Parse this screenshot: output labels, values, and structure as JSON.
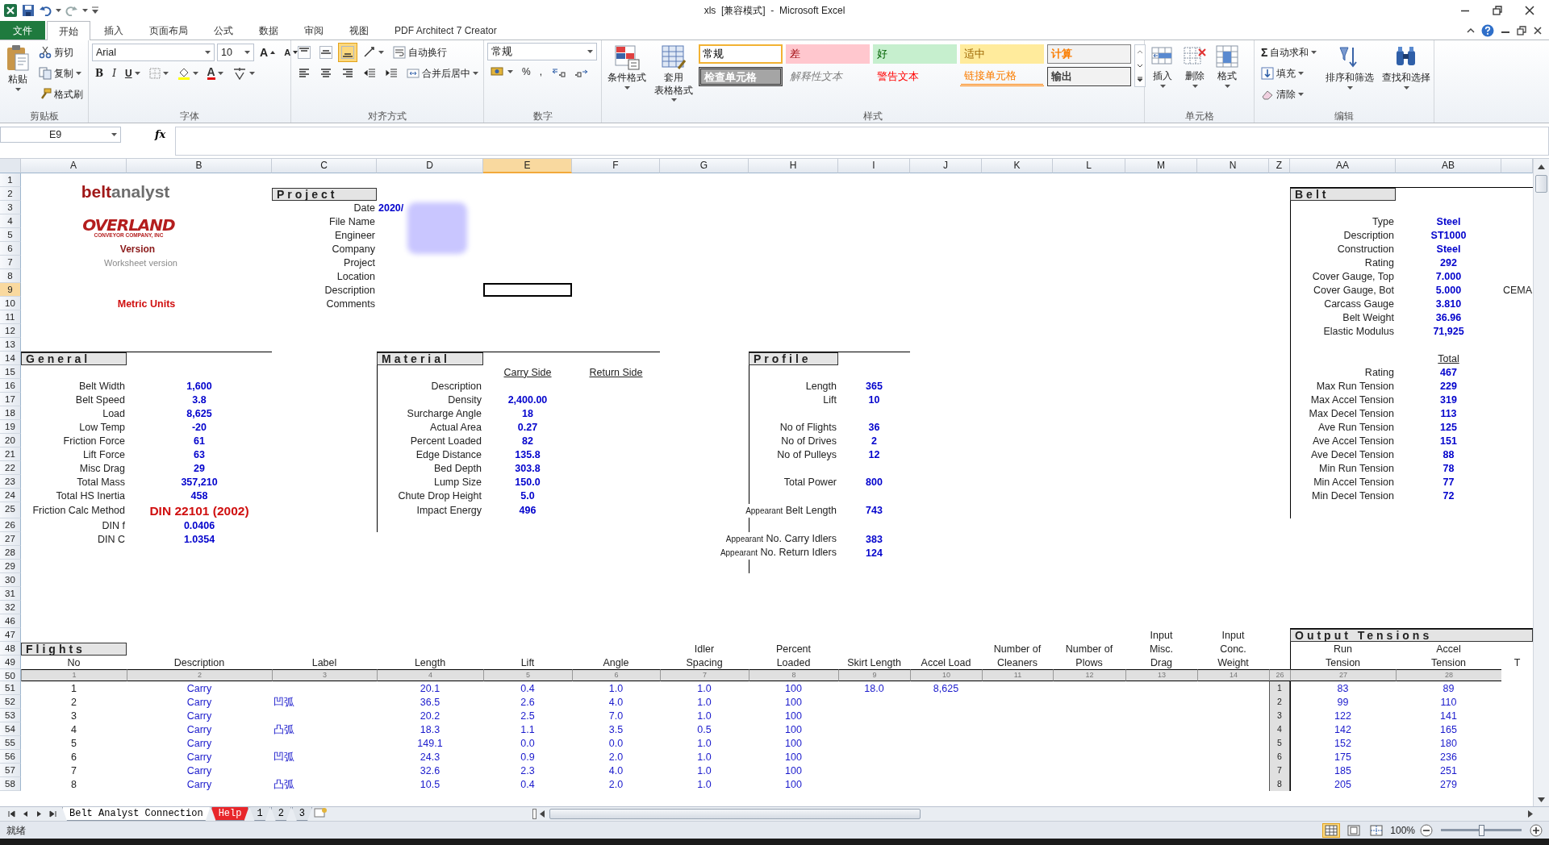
{
  "window": {
    "title": "xls  [兼容模式]  -  Microsoft Excel"
  },
  "tabs": [
    {
      "label": "文件",
      "kind": "file",
      "selected": false
    },
    {
      "label": "开始",
      "kind": "tab",
      "selected": true
    },
    {
      "label": "插入",
      "kind": "tab",
      "selected": false
    },
    {
      "label": "页面布局",
      "kind": "tab",
      "selected": false
    },
    {
      "label": "公式",
      "kind": "tab",
      "selected": false
    },
    {
      "label": "数据",
      "kind": "tab",
      "selected": false
    },
    {
      "label": "审阅",
      "kind": "tab",
      "selected": false
    },
    {
      "label": "视图",
      "kind": "tab",
      "selected": false
    },
    {
      "label": "PDF Architect 7 Creator",
      "kind": "tab",
      "selected": false
    }
  ],
  "ribbon": {
    "clipboard": {
      "label": "剪贴板",
      "paste": "粘贴",
      "cut": "剪切",
      "copy": "复制",
      "painter": "格式刷"
    },
    "font": {
      "label": "字体",
      "name": "Arial",
      "size": "10",
      "grow": "A",
      "shrink": "A",
      "bold": "B",
      "italic": "I",
      "underline": "U",
      "font_color_button": "A"
    },
    "alignment": {
      "label": "对齐方式",
      "vertical": [
        {
          "selected": false
        },
        {
          "selected": false
        },
        {
          "selected": true
        }
      ],
      "wrap": "自动换行",
      "merge": "合并后居中"
    },
    "number": {
      "label": "数字",
      "format": "常规",
      "percent": "%",
      "comma": ","
    },
    "styles": {
      "label": "样式",
      "conditional": "条件格式",
      "table": [
        "套用",
        "表格格式"
      ],
      "gallery": [
        {
          "label": "常规",
          "kind": "normal",
          "selected": true
        },
        {
          "label": "差",
          "kind": "bad",
          "selected": false
        },
        {
          "label": "好",
          "kind": "good",
          "selected": false
        },
        {
          "label": "适中",
          "kind": "neutral",
          "selected": false
        },
        {
          "label": "计算",
          "kind": "calc",
          "selected": false
        },
        {
          "label": "检查单元格",
          "kind": "check",
          "selected": false
        },
        {
          "label": "解释性文本",
          "kind": "explanatory",
          "selected": false
        },
        {
          "label": "警告文本",
          "kind": "warning",
          "selected": false
        },
        {
          "label": "链接单元格",
          "kind": "linked",
          "selected": false
        },
        {
          "label": "输出",
          "kind": "output",
          "selected": false
        }
      ]
    },
    "cells": {
      "label": "单元格",
      "insert": "插入",
      "delete": "删除",
      "format": "格式"
    },
    "editing": {
      "label": "编辑",
      "sum_symbol": "Σ",
      "autosum": "自动求和",
      "fill": "填充",
      "clear": "清除",
      "sort": "排序和筛选",
      "find": "查找和选择"
    }
  },
  "formula_bar": {
    "name_box": "E9",
    "function_label": "fx"
  },
  "columns": [
    {
      "label": "A",
      "selected": false
    },
    {
      "label": "B",
      "selected": false
    },
    {
      "label": "C",
      "selected": false
    },
    {
      "label": "D",
      "selected": false
    },
    {
      "label": "E",
      "selected": true
    },
    {
      "label": "F",
      "selected": false
    },
    {
      "label": "G",
      "selected": false
    },
    {
      "label": "H",
      "selected": false
    },
    {
      "label": "I",
      "selected": false
    },
    {
      "label": "J",
      "selected": false
    },
    {
      "label": "K",
      "selected": false
    },
    {
      "label": "L",
      "selected": false
    },
    {
      "label": "M",
      "selected": false
    },
    {
      "label": "N",
      "selected": false
    },
    {
      "label": "Z",
      "selected": false
    },
    {
      "label": "AA",
      "selected": false
    },
    {
      "label": "AB",
      "selected": false
    }
  ],
  "rows": [
    {
      "row": "1",
      "selected": false
    },
    {
      "row": "2",
      "selected": false,
      "cells": [
        {
          "kind": "logo",
          "parts": [
            "belt",
            "analyst"
          ]
        },
        null,
        {
          "text": "Project",
          "kind": "section"
        },
        null,
        null,
        null,
        null,
        null,
        null,
        null,
        null,
        null,
        null,
        null,
        null,
        {
          "text": "Belt",
          "kind": "section"
        }
      ]
    },
    {
      "row": "3",
      "selected": false,
      "cells": [
        null,
        null,
        {
          "text": "Date",
          "kind": "label"
        },
        {
          "text": "2020/",
          "kind": "valueleft"
        }
      ]
    },
    {
      "row": "4",
      "selected": false,
      "cells": [
        {
          "kind": "overland",
          "text": "OVERLAND",
          "subtitle": "CONVEYOR COMPANY, INC"
        },
        null,
        {
          "text": "File Name",
          "kind": "label"
        },
        null,
        null,
        null,
        null,
        null,
        null,
        null,
        null,
        null,
        null,
        null,
        null,
        {
          "text": "Type",
          "kind": "label"
        },
        {
          "text": "Steel",
          "kind": "value"
        }
      ]
    },
    {
      "row": "5",
      "selected": false,
      "cells": [
        null,
        null,
        {
          "text": "Engineer",
          "kind": "label"
        },
        null,
        null,
        null,
        null,
        null,
        null,
        null,
        null,
        null,
        null,
        null,
        null,
        {
          "text": "Description",
          "kind": "label"
        },
        {
          "text": "ST1000",
          "kind": "value"
        }
      ]
    },
    {
      "row": "6",
      "selected": false,
      "cells": [
        {
          "text": "Version",
          "kind": "version"
        },
        null,
        {
          "text": "Company",
          "kind": "label"
        },
        null,
        null,
        null,
        null,
        null,
        null,
        null,
        null,
        null,
        null,
        null,
        null,
        {
          "text": "Construction",
          "kind": "label"
        },
        {
          "text": "Steel",
          "kind": "value"
        }
      ]
    },
    {
      "row": "7",
      "selected": false,
      "cells": [
        {
          "text": "Worksheet version",
          "kind": "note"
        },
        null,
        {
          "text": "Project",
          "kind": "label"
        },
        null,
        null,
        null,
        null,
        null,
        null,
        null,
        null,
        null,
        null,
        null,
        null,
        {
          "text": "Rating",
          "kind": "label"
        },
        {
          "text": "292",
          "kind": "value"
        }
      ]
    },
    {
      "row": "8",
      "selected": false,
      "cells": [
        null,
        null,
        {
          "text": "Location",
          "kind": "label"
        },
        null,
        null,
        null,
        null,
        null,
        null,
        null,
        null,
        null,
        null,
        null,
        null,
        {
          "text": "Cover Gauge, Top",
          "kind": "label"
        },
        {
          "text": "7.000",
          "kind": "value"
        }
      ]
    },
    {
      "row": "9",
      "selected": true,
      "cells": [
        null,
        null,
        {
          "text": "Description",
          "kind": "label"
        },
        null,
        null,
        null,
        null,
        null,
        null,
        null,
        null,
        null,
        null,
        null,
        null,
        {
          "text": "Cover Gauge, Bot",
          "kind": "label"
        },
        {
          "text": "5.000",
          "kind": "value"
        },
        {
          "text": "CEMA",
          "kind": "text"
        }
      ]
    },
    {
      "row": "10",
      "selected": false,
      "cells": [
        {
          "text": "Metric Units",
          "kind": "units"
        },
        null,
        {
          "text": "Comments",
          "kind": "label"
        },
        null,
        null,
        null,
        null,
        null,
        null,
        null,
        null,
        null,
        null,
        null,
        null,
        {
          "text": "Carcass Gauge",
          "kind": "label"
        },
        {
          "text": "3.810",
          "kind": "value"
        }
      ]
    },
    {
      "row": "11",
      "selected": false,
      "cells": [
        null,
        null,
        null,
        null,
        null,
        null,
        null,
        null,
        null,
        null,
        null,
        null,
        null,
        null,
        null,
        {
          "text": "Belt Weight",
          "kind": "label"
        },
        {
          "text": "36.96",
          "kind": "value"
        }
      ]
    },
    {
      "row": "12",
      "selected": false,
      "cells": [
        null,
        null,
        null,
        null,
        null,
        null,
        null,
        null,
        null,
        null,
        null,
        null,
        null,
        null,
        null,
        {
          "text": "Elastic Modulus",
          "kind": "label"
        },
        {
          "text": "71,925",
          "kind": "value"
        }
      ]
    },
    {
      "row": "13",
      "selected": false
    },
    {
      "row": "14",
      "selected": false,
      "cells": [
        {
          "text": "General",
          "kind": "section"
        },
        null,
        null,
        {
          "text": "Material",
          "kind": "section"
        },
        null,
        null,
        null,
        {
          "text": "Profile",
          "kind": "section"
        },
        null,
        null,
        null,
        null,
        null,
        null,
        null,
        null,
        {
          "text": "Total",
          "kind": "under"
        }
      ]
    },
    {
      "row": "15",
      "selected": false,
      "cells": [
        null,
        null,
        null,
        null,
        {
          "text": "Carry Side",
          "kind": "under"
        },
        {
          "text": "Return Side",
          "kind": "under"
        },
        null,
        null,
        null,
        null,
        null,
        null,
        null,
        null,
        null,
        {
          "text": "Rating",
          "kind": "label"
        },
        {
          "text": "467",
          "kind": "value"
        }
      ]
    },
    {
      "row": "16",
      "selected": false,
      "cells": [
        {
          "text": "Belt Width",
          "kind": "label"
        },
        {
          "text": "1,600",
          "kind": "value"
        },
        null,
        {
          "text": "Description",
          "kind": "label"
        },
        null,
        null,
        null,
        {
          "text": "Length",
          "kind": "label"
        },
        {
          "text": "365",
          "kind": "value"
        },
        null,
        null,
        null,
        null,
        null,
        null,
        {
          "text": "Max Run Tension",
          "kind": "label"
        },
        {
          "text": "229",
          "kind": "value"
        }
      ]
    },
    {
      "row": "17",
      "selected": false,
      "cells": [
        {
          "text": "Belt Speed",
          "kind": "label"
        },
        {
          "text": "3.8",
          "kind": "value"
        },
        null,
        {
          "text": "Density",
          "kind": "label"
        },
        {
          "text": "2,400.00",
          "kind": "value"
        },
        null,
        null,
        {
          "text": "Lift",
          "kind": "label"
        },
        {
          "text": "10",
          "kind": "value"
        },
        null,
        null,
        null,
        null,
        null,
        null,
        {
          "text": "Max Accel Tension",
          "kind": "label"
        },
        {
          "text": "319",
          "kind": "value"
        }
      ]
    },
    {
      "row": "18",
      "selected": false,
      "cells": [
        {
          "text": "Load",
          "kind": "label"
        },
        {
          "text": "8,625",
          "kind": "value"
        },
        null,
        {
          "text": "Surcharge Angle",
          "kind": "label"
        },
        {
          "text": "18",
          "kind": "value"
        },
        null,
        null,
        null,
        null,
        null,
        null,
        null,
        null,
        null,
        null,
        {
          "text": "Max Decel Tension",
          "kind": "label"
        },
        {
          "text": "113",
          "kind": "value"
        }
      ]
    },
    {
      "row": "19",
      "selected": false,
      "cells": [
        {
          "text": "Low Temp",
          "kind": "label"
        },
        {
          "text": "-20",
          "kind": "value"
        },
        null,
        {
          "text": "Actual Area",
          "kind": "label"
        },
        {
          "text": "0.27",
          "kind": "value"
        },
        null,
        null,
        {
          "text": "No of Flights",
          "kind": "label"
        },
        {
          "text": "36",
          "kind": "value"
        },
        null,
        null,
        null,
        null,
        null,
        null,
        {
          "text": "Ave Run Tension",
          "kind": "label"
        },
        {
          "text": "125",
          "kind": "value"
        }
      ]
    },
    {
      "row": "20",
      "selected": false,
      "cells": [
        {
          "text": "Friction Force",
          "kind": "label"
        },
        {
          "text": "61",
          "kind": "value"
        },
        null,
        {
          "text": "Percent Loaded",
          "kind": "label"
        },
        {
          "text": "82",
          "kind": "value"
        },
        null,
        null,
        {
          "text": "No of Drives",
          "kind": "label"
        },
        {
          "text": "2",
          "kind": "value"
        },
        null,
        null,
        null,
        null,
        null,
        null,
        {
          "text": "Ave Accel Tension",
          "kind": "label"
        },
        {
          "text": "151",
          "kind": "value"
        }
      ]
    },
    {
      "row": "21",
      "selected": false,
      "cells": [
        {
          "text": "Lift Force",
          "kind": "label"
        },
        {
          "text": "63",
          "kind": "value"
        },
        null,
        {
          "text": "Edge Distance",
          "kind": "label"
        },
        {
          "text": "135.8",
          "kind": "value"
        },
        null,
        null,
        {
          "text": "No of Pulleys",
          "kind": "label"
        },
        {
          "text": "12",
          "kind": "value"
        },
        null,
        null,
        null,
        null,
        null,
        null,
        {
          "text": "Ave Decel Tension",
          "kind": "label"
        },
        {
          "text": "88",
          "kind": "value"
        }
      ]
    },
    {
      "row": "22",
      "selected": false,
      "cells": [
        {
          "text": "Misc Drag",
          "kind": "label"
        },
        {
          "text": "29",
          "kind": "value"
        },
        null,
        {
          "text": "Bed Depth",
          "kind": "label"
        },
        {
          "text": "303.8",
          "kind": "value"
        },
        null,
        null,
        null,
        null,
        null,
        null,
        null,
        null,
        null,
        null,
        {
          "text": "Min Run Tension",
          "kind": "label"
        },
        {
          "text": "78",
          "kind": "value"
        }
      ]
    },
    {
      "row": "23",
      "selected": false,
      "cells": [
        {
          "text": "Total Mass",
          "kind": "label"
        },
        {
          "text": "357,210",
          "kind": "value"
        },
        null,
        {
          "text": "Lump Size",
          "kind": "label"
        },
        {
          "text": "150.0",
          "kind": "value"
        },
        null,
        null,
        {
          "text": "Total Power",
          "kind": "label"
        },
        {
          "text": "800",
          "kind": "value"
        },
        null,
        null,
        null,
        null,
        null,
        null,
        {
          "text": "Min Accel Tension",
          "kind": "label"
        },
        {
          "text": "77",
          "kind": "value"
        }
      ]
    },
    {
      "row": "24",
      "selected": false,
      "cells": [
        {
          "text": "Total HS Inertia",
          "kind": "label"
        },
        {
          "text": "458",
          "kind": "value"
        },
        null,
        {
          "text": "Chute Drop Height",
          "kind": "label"
        },
        {
          "text": "5.0",
          "kind": "value"
        },
        null,
        null,
        null,
        null,
        null,
        null,
        null,
        null,
        null,
        null,
        {
          "text": "Min Decel Tension",
          "kind": "label"
        },
        {
          "text": "72",
          "kind": "value"
        }
      ]
    },
    {
      "row": "25",
      "selected": false,
      "cells": [
        {
          "text": "Friction Calc Method",
          "kind": "label"
        },
        {
          "text": "DIN 22101 (2002)",
          "kind": "red"
        },
        null,
        {
          "text": "Impact Energy",
          "kind": "label"
        },
        {
          "text": "496",
          "kind": "value"
        },
        null,
        null,
        {
          "kind": "prefixed",
          "prefix": "Appearant",
          "text": "Belt Length"
        },
        {
          "text": "743",
          "kind": "value"
        }
      ]
    },
    {
      "row": "26",
      "selected": false,
      "cells": [
        {
          "text": "DIN f",
          "kind": "label"
        },
        {
          "text": "0.0406",
          "kind": "value"
        }
      ]
    },
    {
      "row": "27",
      "selected": false,
      "cells": [
        {
          "text": "DIN C",
          "kind": "label"
        },
        {
          "text": "1.0354",
          "kind": "value"
        },
        null,
        null,
        null,
        null,
        null,
        {
          "kind": "prefixed",
          "prefix": "Appearant",
          "text": "No. Carry Idlers"
        },
        {
          "text": "383",
          "kind": "value"
        }
      ]
    },
    {
      "row": "28",
      "selected": false,
      "cells": [
        null,
        null,
        null,
        null,
        null,
        null,
        null,
        {
          "kind": "prefixed",
          "prefix": "Appearant",
          "text": "No. Return Idlers"
        },
        {
          "text": "124",
          "kind": "value"
        }
      ]
    },
    {
      "row": "29",
      "selected": false
    },
    {
      "row": "30",
      "selected": false
    },
    {
      "row": "31",
      "selected": false
    },
    {
      "row": "32",
      "selected": false
    },
    {
      "row": "46",
      "selected": false
    },
    {
      "row": "47",
      "selected": false,
      "cells": [
        null,
        null,
        null,
        null,
        null,
        null,
        null,
        null,
        null,
        null,
        null,
        null,
        {
          "text": "Input",
          "kind": "head"
        },
        {
          "text": "Input",
          "kind": "head"
        },
        null,
        {
          "text": "Output Tensions",
          "kind": "wide"
        }
      ]
    },
    {
      "row": "48",
      "selected": false,
      "cells": [
        {
          "text": "Flights",
          "kind": "section"
        },
        null,
        null,
        null,
        null,
        null,
        {
          "text": "Idler",
          "kind": "head"
        },
        {
          "text": "Percent",
          "kind": "head"
        },
        null,
        null,
        {
          "text": "Number of",
          "kind": "head"
        },
        {
          "text": "Number of",
          "kind": "head"
        },
        {
          "text": "Misc.",
          "kind": "head"
        },
        {
          "text": "Conc.",
          "kind": "head"
        },
        null,
        {
          "text": "Run",
          "kind": "head"
        },
        {
          "text": "Accel",
          "kind": "head"
        }
      ]
    },
    {
      "row": "49",
      "selected": false,
      "cells": [
        {
          "text": "No",
          "kind": "head"
        },
        {
          "text": "Description",
          "kind": "head"
        },
        {
          "text": "Label",
          "kind": "head"
        },
        {
          "text": "Length",
          "kind": "head"
        },
        {
          "text": "Lift",
          "kind": "head"
        },
        {
          "text": "Angle",
          "kind": "head"
        },
        {
          "text": "Spacing",
          "kind": "head"
        },
        {
          "text": "Loaded",
          "kind": "head"
        },
        {
          "text": "Skirt Length",
          "kind": "head"
        },
        {
          "text": "Accel Load",
          "kind": "head"
        },
        {
          "text": "Cleaners",
          "kind": "head"
        },
        {
          "text": "Plows",
          "kind": "head"
        },
        {
          "text": "Drag",
          "kind": "head"
        },
        {
          "text": "Weight",
          "kind": "head"
        },
        null,
        {
          "text": "Tension",
          "kind": "head"
        },
        {
          "text": "Tension",
          "kind": "head"
        },
        {
          "text": "T",
          "kind": "head"
        }
      ]
    },
    {
      "row": "50",
      "selected": false,
      "cells": [
        {
          "text": "1",
          "kind": "colnum"
        },
        {
          "text": "2",
          "kind": "colnum"
        },
        {
          "text": "3",
          "kind": "colnum"
        },
        {
          "text": "4",
          "kind": "colnum"
        },
        {
          "text": "5",
          "kind": "colnum"
        },
        {
          "text": "6",
          "kind": "colnum"
        },
        {
          "text": "7",
          "kind": "colnum"
        },
        {
          "text": "8",
          "kind": "colnum"
        },
        {
          "text": "9",
          "kind": "colnum"
        },
        {
          "text": "10",
          "kind": "colnum"
        },
        {
          "text": "11",
          "kind": "colnum"
        },
        {
          "text": "12",
          "kind": "colnum"
        },
        {
          "text": "13",
          "kind": "colnum"
        },
        {
          "text": "14",
          "kind": "colnum"
        },
        {
          "text": "26",
          "kind": "colnum"
        },
        {
          "text": "27",
          "kind": "colnum"
        },
        {
          "text": "28",
          "kind": "colnum"
        }
      ]
    },
    {
      "row": "51",
      "selected": false,
      "cells": [
        {
          "text": "1",
          "kind": "num"
        },
        {
          "text": "Carry",
          "kind": "data"
        },
        null,
        {
          "text": "20.1",
          "kind": "data"
        },
        {
          "text": "0.4",
          "kind": "data"
        },
        {
          "text": "1.0",
          "kind": "data"
        },
        {
          "text": "1.0",
          "kind": "data"
        },
        {
          "text": "100",
          "kind": "data"
        },
        {
          "text": "18.0",
          "kind": "data"
        },
        {
          "text": "8,625",
          "kind": "data"
        },
        null,
        null,
        null,
        null,
        {
          "text": "1",
          "kind": "rownum"
        },
        {
          "text": "83",
          "kind": "data"
        },
        {
          "text": "89",
          "kind": "data"
        }
      ]
    },
    {
      "row": "52",
      "selected": false,
      "cells": [
        {
          "text": "2",
          "kind": "num"
        },
        {
          "text": "Carry",
          "kind": "data"
        },
        {
          "text": "凹弧",
          "kind": "dataleft"
        },
        {
          "text": "36.5",
          "kind": "data"
        },
        {
          "text": "2.6",
          "kind": "data"
        },
        {
          "text": "4.0",
          "kind": "data"
        },
        {
          "text": "1.0",
          "kind": "data"
        },
        {
          "text": "100",
          "kind": "data"
        },
        null,
        null,
        null,
        null,
        null,
        null,
        {
          "text": "2",
          "kind": "rownum"
        },
        {
          "text": "99",
          "kind": "data"
        },
        {
          "text": "110",
          "kind": "data"
        }
      ]
    },
    {
      "row": "53",
      "selected": false,
      "cells": [
        {
          "text": "3",
          "kind": "num"
        },
        {
          "text": "Carry",
          "kind": "data"
        },
        null,
        {
          "text": "20.2",
          "kind": "data"
        },
        {
          "text": "2.5",
          "kind": "data"
        },
        {
          "text": "7.0",
          "kind": "data"
        },
        {
          "text": "1.0",
          "kind": "data"
        },
        {
          "text": "100",
          "kind": "data"
        },
        null,
        null,
        null,
        null,
        null,
        null,
        {
          "text": "3",
          "kind": "rownum"
        },
        {
          "text": "122",
          "kind": "data"
        },
        {
          "text": "141",
          "kind": "data"
        }
      ]
    },
    {
      "row": "54",
      "selected": false,
      "cells": [
        {
          "text": "4",
          "kind": "num"
        },
        {
          "text": "Carry",
          "kind": "data"
        },
        {
          "text": "凸弧",
          "kind": "dataleft"
        },
        {
          "text": "18.3",
          "kind": "data"
        },
        {
          "text": "1.1",
          "kind": "data"
        },
        {
          "text": "3.5",
          "kind": "data"
        },
        {
          "text": "0.5",
          "kind": "data"
        },
        {
          "text": "100",
          "kind": "data"
        },
        null,
        null,
        null,
        null,
        null,
        null,
        {
          "text": "4",
          "kind": "rownum"
        },
        {
          "text": "142",
          "kind": "data"
        },
        {
          "text": "165",
          "kind": "data"
        }
      ]
    },
    {
      "row": "55",
      "selected": false,
      "cells": [
        {
          "text": "5",
          "kind": "num"
        },
        {
          "text": "Carry",
          "kind": "data"
        },
        null,
        {
          "text": "149.1",
          "kind": "data"
        },
        {
          "text": "0.0",
          "kind": "data"
        },
        {
          "text": "0.0",
          "kind": "data"
        },
        {
          "text": "1.0",
          "kind": "data"
        },
        {
          "text": "100",
          "kind": "data"
        },
        null,
        null,
        null,
        null,
        null,
        null,
        {
          "text": "5",
          "kind": "rownum"
        },
        {
          "text": "152",
          "kind": "data"
        },
        {
          "text": "180",
          "kind": "data"
        }
      ]
    },
    {
      "row": "56",
      "selected": false,
      "cells": [
        {
          "text": "6",
          "kind": "num"
        },
        {
          "text": "Carry",
          "kind": "data"
        },
        {
          "text": "凹弧",
          "kind": "dataleft"
        },
        {
          "text": "24.3",
          "kind": "data"
        },
        {
          "text": "0.9",
          "kind": "data"
        },
        {
          "text": "2.0",
          "kind": "data"
        },
        {
          "text": "1.0",
          "kind": "data"
        },
        {
          "text": "100",
          "kind": "data"
        },
        null,
        null,
        null,
        null,
        null,
        null,
        {
          "text": "6",
          "kind": "rownum"
        },
        {
          "text": "175",
          "kind": "data"
        },
        {
          "text": "236",
          "kind": "data"
        }
      ]
    },
    {
      "row": "57",
      "selected": false,
      "cells": [
        {
          "text": "7",
          "kind": "num"
        },
        {
          "text": "Carry",
          "kind": "data"
        },
        null,
        {
          "text": "32.6",
          "kind": "data"
        },
        {
          "text": "2.3",
          "kind": "data"
        },
        {
          "text": "4.0",
          "kind": "data"
        },
        {
          "text": "1.0",
          "kind": "data"
        },
        {
          "text": "100",
          "kind": "data"
        },
        null,
        null,
        null,
        null,
        null,
        null,
        {
          "text": "7",
          "kind": "rownum"
        },
        {
          "text": "185",
          "kind": "data"
        },
        {
          "text": "251",
          "kind": "data"
        }
      ]
    },
    {
      "row": "58",
      "selected": false,
      "cells": [
        {
          "text": "8",
          "kind": "num"
        },
        {
          "text": "Carry",
          "kind": "data"
        },
        {
          "text": "凸弧",
          "kind": "dataleft"
        },
        {
          "text": "10.5",
          "kind": "data"
        },
        {
          "text": "0.4",
          "kind": "data"
        },
        {
          "text": "2.0",
          "kind": "data"
        },
        {
          "text": "1.0",
          "kind": "data"
        },
        {
          "text": "100",
          "kind": "data"
        },
        null,
        null,
        null,
        null,
        null,
        null,
        {
          "text": "8",
          "kind": "rownum"
        },
        {
          "text": "205",
          "kind": "data"
        },
        {
          "text": "279",
          "kind": "data"
        }
      ]
    }
  ],
  "sheet_tabs": [
    {
      "label": "Belt Analyst Connection",
      "selected": true
    },
    {
      "label": "Help",
      "selected": false,
      "color": "#e8262a"
    },
    {
      "label": "1",
      "selected": false
    },
    {
      "label": "2",
      "selected": false
    },
    {
      "label": "3",
      "selected": false
    }
  ],
  "status_bar": {
    "text": "就绪",
    "views": [
      {
        "selected": true
      },
      {
        "selected": false
      },
      {
        "selected": false
      }
    ],
    "zoom": "100%",
    "zoom_slider": {
      "level": 0.5
    }
  }
}
